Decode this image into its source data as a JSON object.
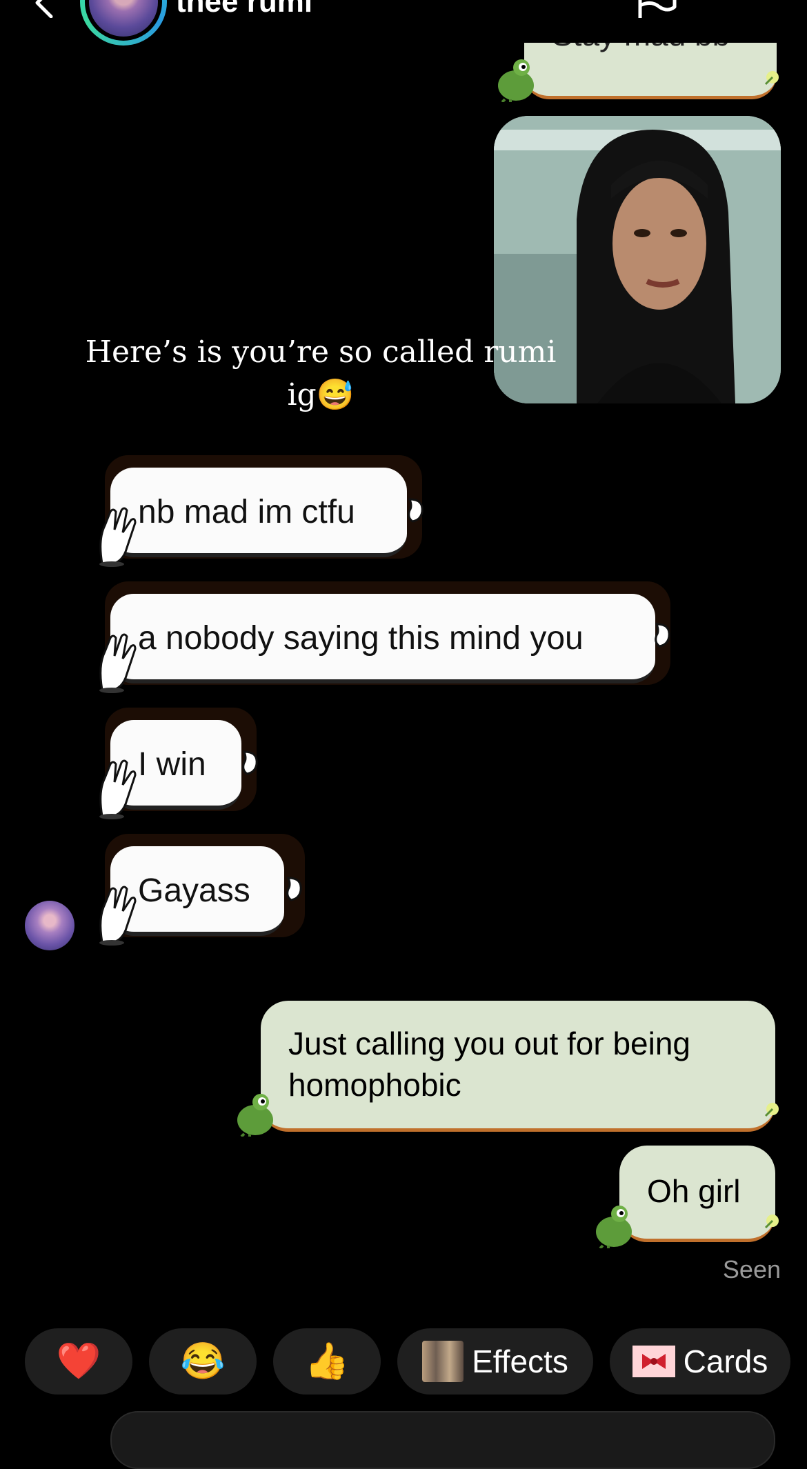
{
  "header": {
    "contact_name": "thee rumi"
  },
  "messages": {
    "top_sent_partial": "Stay mad bb",
    "caption": "Here’s is you’re so called rumi ig😅",
    "received": [
      "nb mad im ctfu",
      "a nobody saying this mind you",
      "I win",
      "Gayass"
    ],
    "sent_1": "Just calling you out for being homophobic",
    "sent_2": "Oh girl",
    "seen": "Seen"
  },
  "quick_actions": {
    "heart": "❤️",
    "laugh": "😂",
    "thumbs": "👍",
    "effects_label": "Effects",
    "cards_label": "Cards"
  },
  "colors": {
    "sent_bubble": "#dbe5d0",
    "received_bubble": "#fbfbfb",
    "chip_bg": "#1f1f1f",
    "background": "#000000"
  }
}
